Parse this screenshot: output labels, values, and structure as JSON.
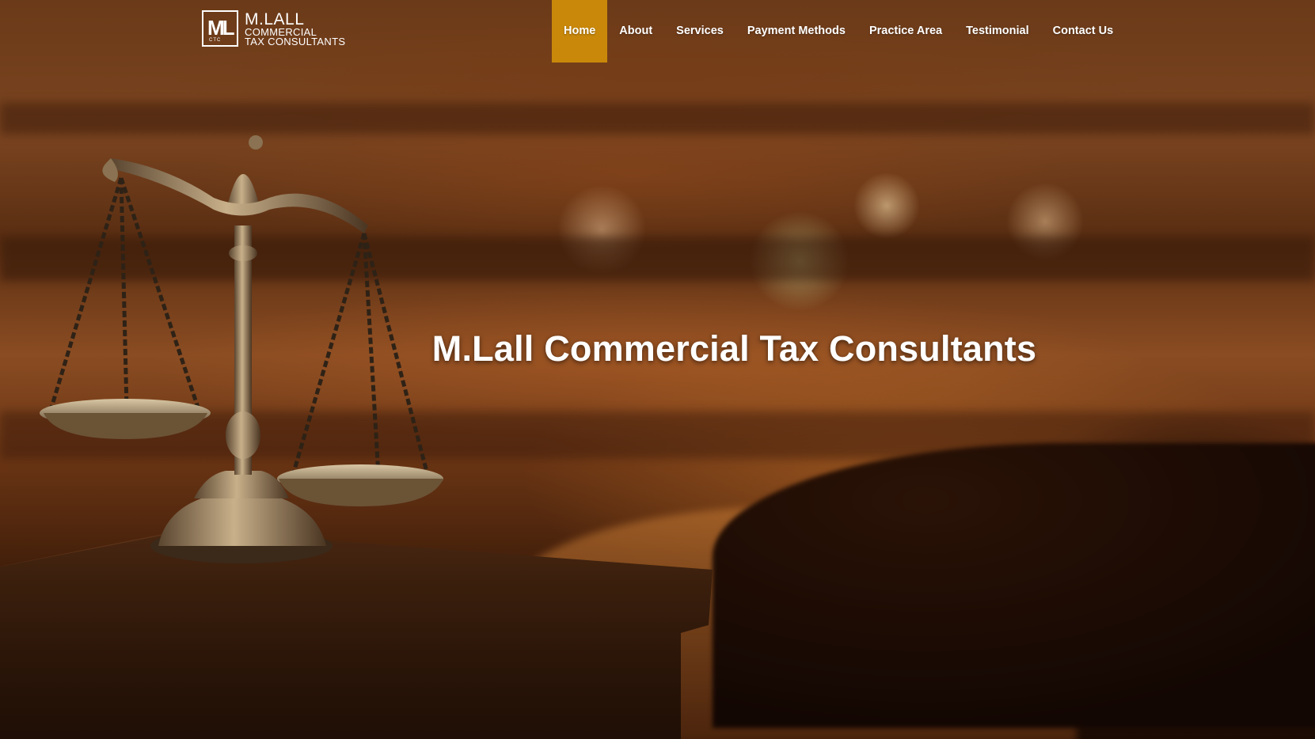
{
  "brand": {
    "mark_letters": "ML",
    "mark_sub": "CTC",
    "name": "M.LALL",
    "line1": "COMMERCIAL",
    "line2": "TAX CONSULTANTS"
  },
  "nav": {
    "items": [
      {
        "label": "Home",
        "active": true
      },
      {
        "label": "About",
        "active": false
      },
      {
        "label": "Services",
        "active": false
      },
      {
        "label": "Payment Methods",
        "active": false
      },
      {
        "label": "Practice Area",
        "active": false
      },
      {
        "label": "Testimonial",
        "active": false
      },
      {
        "label": "Contact Us",
        "active": false
      }
    ],
    "active_color": "#c9880a"
  },
  "hero": {
    "title": "M.Lall Commercial Tax Consultants",
    "background_description_icon": "scales-of-justice-icon"
  },
  "colors": {
    "accent": "#c9880a",
    "text": "#ffffff"
  }
}
